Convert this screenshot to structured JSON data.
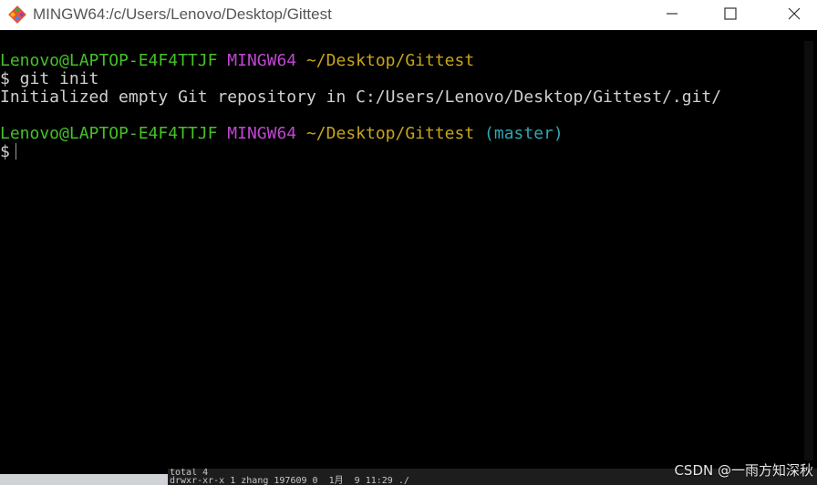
{
  "window": {
    "title": "MINGW64:/c/Users/Lenovo/Desktop/Gittest",
    "icon": "git-bash-icon"
  },
  "controls": {
    "minimize": "minimize-icon",
    "maximize": "maximize-icon",
    "close": "close-icon"
  },
  "terminal": {
    "prompt1": {
      "user": "Lenovo@LAPTOP-E4F4TTJF",
      "system": "MINGW64",
      "path": "~/Desktop/Gittest"
    },
    "command1": "$ git init",
    "output1": "Initialized empty Git repository in C:/Users/Lenovo/Desktop/Gittest/.git/",
    "prompt2": {
      "user": "Lenovo@LAPTOP-E4F4TTJF",
      "system": "MINGW64",
      "path": "~/Desktop/Gittest",
      "branch": "(master)"
    },
    "prompt_symbol": "$"
  },
  "background_window": {
    "line1": "total 4",
    "line2": "drwxr-xr-x 1 zhang 197609 0  1月  9 11:29 ./"
  },
  "watermark": "CSDN @一雨方知深秋",
  "colors": {
    "user": "#46c028",
    "system": "#c046d3",
    "path": "#c9a51b",
    "branch": "#2fa8b3",
    "terminal_bg": "#000000"
  }
}
